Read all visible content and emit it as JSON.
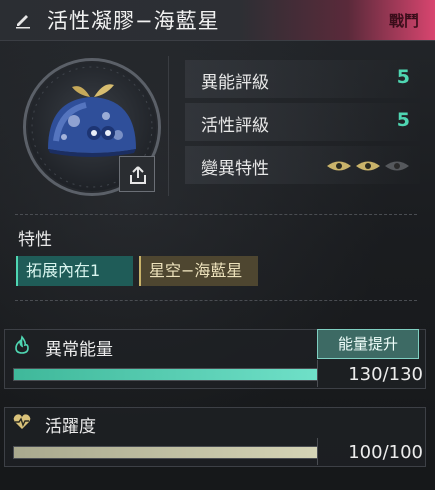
{
  "header": {
    "title": "活性凝膠−海藍星",
    "tag": "戰鬥"
  },
  "stats": [
    {
      "label": "異能評級",
      "value": "5"
    },
    {
      "label": "活性評級",
      "value": "5"
    },
    {
      "label": "變異特性",
      "eyes_active": 2,
      "eyes_total": 3
    }
  ],
  "traits": {
    "title": "特性",
    "items": [
      "拓展內在1",
      "星空−海藍星"
    ]
  },
  "energy": {
    "label": "異常能量",
    "button": "能量提升",
    "value_text": "130/130",
    "current": 130,
    "max": 130
  },
  "vitality": {
    "label": "活躍度",
    "value_text": "100/100",
    "current": 100,
    "max": 100
  },
  "colors": {
    "accent_teal": "#4fd6b2",
    "header_pink": "#d8456f",
    "eye_gold": "#c9b36a"
  }
}
